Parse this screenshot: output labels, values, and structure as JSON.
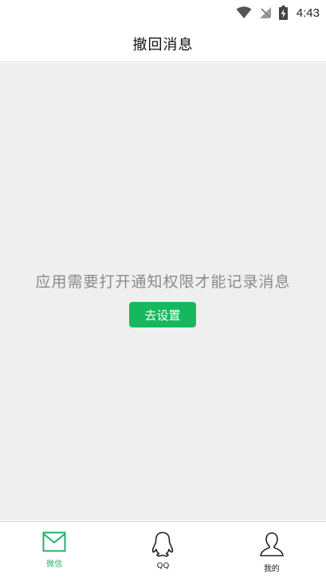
{
  "status_bar": {
    "time": "4:43",
    "icons": [
      "wifi-icon",
      "no-signal-icon",
      "battery-charging-icon"
    ]
  },
  "header": {
    "title": "撤回消息"
  },
  "main": {
    "notice": "应用需要打开通知权限才能记录消息",
    "settings_button_label": "去设置"
  },
  "tab_bar": {
    "tabs": [
      {
        "label": "微信",
        "icon": "mail-icon",
        "active": true
      },
      {
        "label": "QQ",
        "icon": "qq-penguin-icon",
        "active": false
      },
      {
        "label": "我的",
        "icon": "user-icon",
        "active": false
      }
    ]
  },
  "colors": {
    "accent": "#17b85d",
    "active_tab": "#1eb26a",
    "content_bg": "#efefef",
    "notice_text": "#8a8a8a"
  }
}
